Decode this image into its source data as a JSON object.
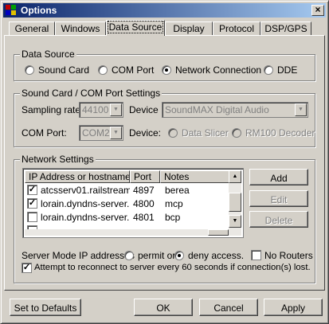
{
  "window": {
    "title": "Options",
    "close_glyph": "×"
  },
  "tabs": [
    {
      "label": "General"
    },
    {
      "label": "Windows"
    },
    {
      "label": "Data Source",
      "active": true
    },
    {
      "label": "Display"
    },
    {
      "label": "Protocol"
    },
    {
      "label": "DSP/GPS"
    }
  ],
  "data_source": {
    "group_label": "Data Source",
    "options": [
      {
        "label": "Sound Card",
        "checked": false
      },
      {
        "label": "COM Port",
        "checked": false
      },
      {
        "label": "Network Connection",
        "checked": true
      },
      {
        "label": "DDE",
        "checked": false
      }
    ]
  },
  "soundcard_settings": {
    "group_label": "Sound Card / COM Port Settings",
    "sampling_rate_label": "Sampling rate",
    "sampling_rate_value": "44100",
    "device_label": "Device",
    "device_value": "SoundMAX Digital Audio",
    "com_port_label": "COM Port:",
    "com_port_value": "COM2",
    "com_device_label": "Device:",
    "data_slicer_label": "Data Slicer",
    "rm100_label": "RM100 Decoder"
  },
  "network_settings": {
    "group_label": "Network Settings",
    "columns": [
      "IP Address or hostname",
      "Port",
      "Notes"
    ],
    "rows": [
      {
        "checked": true,
        "host": "atcsserv01.railstream....",
        "port": "4897",
        "notes": "berea"
      },
      {
        "checked": true,
        "host": "lorain.dyndns-server....",
        "port": "4800",
        "notes": "mcp"
      },
      {
        "checked": false,
        "host": "lorain.dyndns-server....",
        "port": "4801",
        "notes": "bcp"
      },
      {
        "checked": false,
        "host": "",
        "port": "",
        "notes": ""
      }
    ],
    "add_label": "Add",
    "edit_label": "Edit",
    "delete_label": "Delete",
    "server_mode_label": "Server Mode IP addresses",
    "permit_label": "permit or",
    "deny_label": "deny access.",
    "no_routers_label": "No Routers",
    "reconnect_label": "Attempt to reconnect to server every 60 seconds if connection(s) lost.",
    "permit_checked": false,
    "deny_checked": true,
    "no_routers_checked": false,
    "reconnect_checked": true
  },
  "footer": {
    "defaults_label": "Set to Defaults",
    "ok_label": "OK",
    "cancel_label": "Cancel",
    "apply_label": "Apply"
  },
  "colors": {
    "titlebar_start": "#0a246a",
    "titlebar_end": "#a6caf0",
    "face": "#d4d0c8"
  }
}
